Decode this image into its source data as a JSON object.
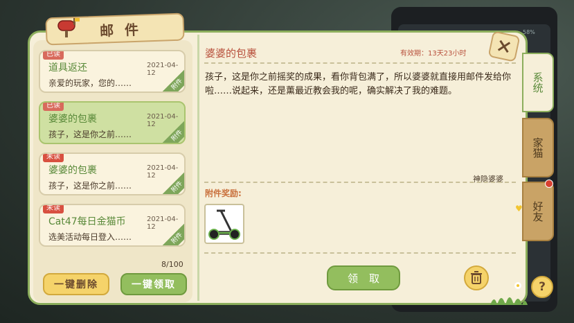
{
  "header": {
    "title": "邮件"
  },
  "mails": [
    {
      "status": "已读",
      "title": "道具返还",
      "date": "2021-04-12",
      "preview": "亲爱的玩家，您的……",
      "attach": "附件"
    },
    {
      "status": "已读",
      "title": "婆婆的包裹",
      "date": "2021-04-12",
      "preview": "孩子，这是你之前……",
      "attach": "附件"
    },
    {
      "status": "未读",
      "title": "婆婆的包裹",
      "date": "2021-04-12",
      "preview": "孩子，这是你之前……",
      "attach": "附件"
    },
    {
      "status": "未读",
      "title": "Cat47每日金猫币",
      "date": "2021-04-12",
      "preview": "选美活动每日登入……",
      "attach": "附件"
    }
  ],
  "list_footer": {
    "count": "8/100",
    "delete_all": "一键删除",
    "claim_all": "一键领取"
  },
  "detail": {
    "subject": "婆婆的包裹",
    "expiry": "有效期：13天23小时",
    "body": "孩子，这是你之前摇奖的成果，看你背包满了，所以婆婆就直接用邮件发给你啦……说起来，还是薰最近教会我的呢，确实解决了我的难题。",
    "sender": "神隐婆婆",
    "reward_label": "附件奖励:",
    "reward_item_icon": "scooter-icon",
    "claim_label": "领取"
  },
  "tabs": [
    {
      "label": "系统",
      "active": true
    },
    {
      "label": "家猫",
      "active": false
    },
    {
      "label": "好友",
      "active": false,
      "notification": true
    }
  ],
  "phone_status": "58%",
  "colors": {
    "accent_green": "#93be5e",
    "accent_yellow": "#f5d36a",
    "title_red": "#b8503c"
  }
}
